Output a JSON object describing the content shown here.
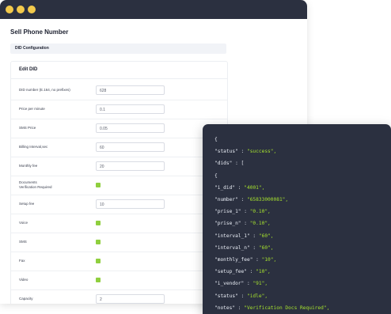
{
  "window_title_dots": [
    "close",
    "minimize",
    "maximize"
  ],
  "page_title": "Sell Phone Number",
  "section_title": "DID Configuration",
  "card_title": "Edit DID",
  "fields": [
    {
      "label": "DID number (E.164, no prefixes)",
      "type": "input",
      "value": "628"
    },
    {
      "label": "Price per minute",
      "type": "input",
      "value": "0.1"
    },
    {
      "label": "SMS Price",
      "type": "input",
      "value": "0.05"
    },
    {
      "label": "Billing Interval,sec",
      "type": "input",
      "value": "60"
    },
    {
      "label": "Monthly fee",
      "type": "input",
      "value": "20"
    },
    {
      "label": "Documents\nVerification Required",
      "type": "checkbox",
      "checked": true
    },
    {
      "label": "Setup fee",
      "type": "input",
      "value": "10"
    },
    {
      "label": "Voice",
      "type": "checkbox",
      "checked": true
    },
    {
      "label": "SMS",
      "type": "checkbox",
      "checked": true
    },
    {
      "label": "Fax",
      "type": "checkbox",
      "checked": true
    },
    {
      "label": "Video",
      "type": "checkbox",
      "checked": true
    },
    {
      "label": "Capacity",
      "type": "input",
      "value": "2"
    }
  ],
  "colors": {
    "titlebar": "#2b3040",
    "dot": "#f2c94c",
    "check": "#8fcf3e",
    "code_bg": "#2b3040",
    "code_string": "#a6e22e"
  },
  "code_lines": [
    {
      "key": "{",
      "val": ""
    },
    {
      "key": "\"status\" : ",
      "val": "\"success\","
    },
    {
      "key": "\"dids\" : [",
      "val": ""
    },
    {
      "key": "{",
      "val": ""
    },
    {
      "key": "\"i_did\" : ",
      "val": "\"4001\","
    },
    {
      "key": "\"number\" : ",
      "val": "\"65833000081\","
    },
    {
      "key": "\"prise_1\" : ",
      "val": "\"0.10\","
    },
    {
      "key": "\"prise_n\" : ",
      "val": "\"0.10\","
    },
    {
      "key": "\"interval_1\" : ",
      "val": "\"60\","
    },
    {
      "key": "\"interval_n\" : ",
      "val": "\"60\","
    },
    {
      "key": "\"monthly_fee\" : ",
      "val": "\"10\","
    },
    {
      "key": "\"setup_fee\" : ",
      "val": "\"10\","
    },
    {
      "key": "\"i_vendor\" : ",
      "val": "\"91\","
    },
    {
      "key": "\"status\" : ",
      "val": "\"idle\","
    },
    {
      "key": "\"notes\" : ",
      "val": "\"Verification Docs Required\","
    }
  ]
}
